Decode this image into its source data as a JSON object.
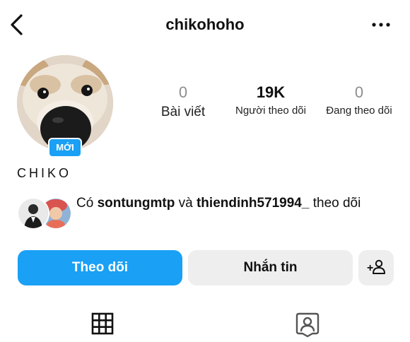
{
  "header": {
    "username": "chikohoho",
    "back_icon": "chevron-left-icon",
    "more_icon": "more-horizontal-icon"
  },
  "profile": {
    "new_badge": "MỚI",
    "display_name": "CHIKO",
    "stats": {
      "posts": {
        "value": "0",
        "label": "Bài viết"
      },
      "followers": {
        "value": "19K",
        "label": "Người theo dõi"
      },
      "following": {
        "value": "0",
        "label": "Đang theo dõi"
      }
    }
  },
  "followed_by": {
    "prefix": "Có",
    "user1": "sontungmtp",
    "connector": "và",
    "user2": "thiendinh571994_",
    "suffix": "theo dõi"
  },
  "actions": {
    "follow_label": "Theo dõi",
    "message_label": "Nhắn tin",
    "add_user_label": "+"
  },
  "tabs": {
    "grid_icon": "grid-icon",
    "tagged_icon": "tagged-person-icon"
  },
  "colors": {
    "accent": "#1aa0f5",
    "secondary_button": "#eeeeee",
    "muted_text": "#8e8e8e"
  }
}
